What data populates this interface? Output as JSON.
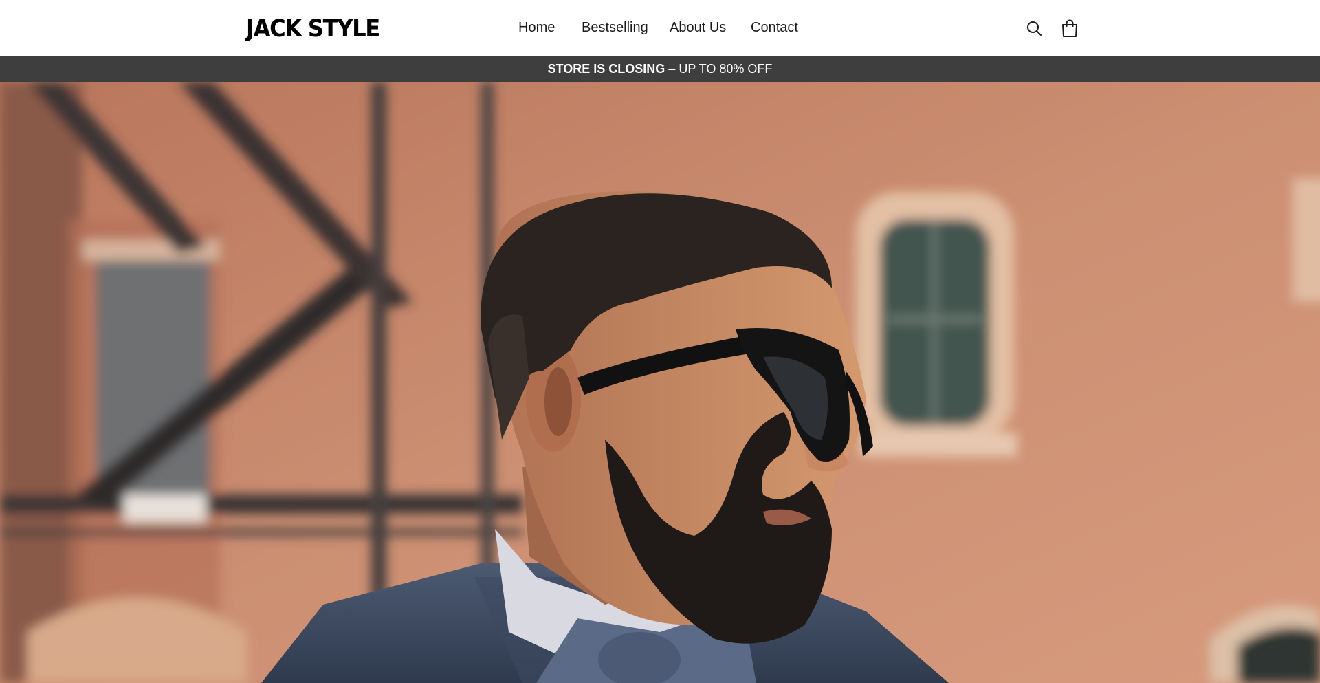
{
  "header": {
    "logo_text": "JACK STYLE",
    "nav": [
      {
        "label": "Home"
      },
      {
        "label": "Bestselling"
      },
      {
        "label": "About Us"
      },
      {
        "label": "Contact"
      }
    ],
    "icons": {
      "search": "search-icon",
      "cart": "cart-icon"
    }
  },
  "announcement": {
    "bold": "STORE IS CLOSING",
    "rest": " – UP TO 80% OFF"
  },
  "hero": {
    "image": "man-with-sunglasses-and-beard-in-blue-suit-bow-tie-brick-building-background"
  },
  "colors": {
    "header_bg": "#ffffff",
    "announcement_bg": "#3e3e3e",
    "text": "#1c1c1c",
    "brick": "#c98a6c"
  }
}
